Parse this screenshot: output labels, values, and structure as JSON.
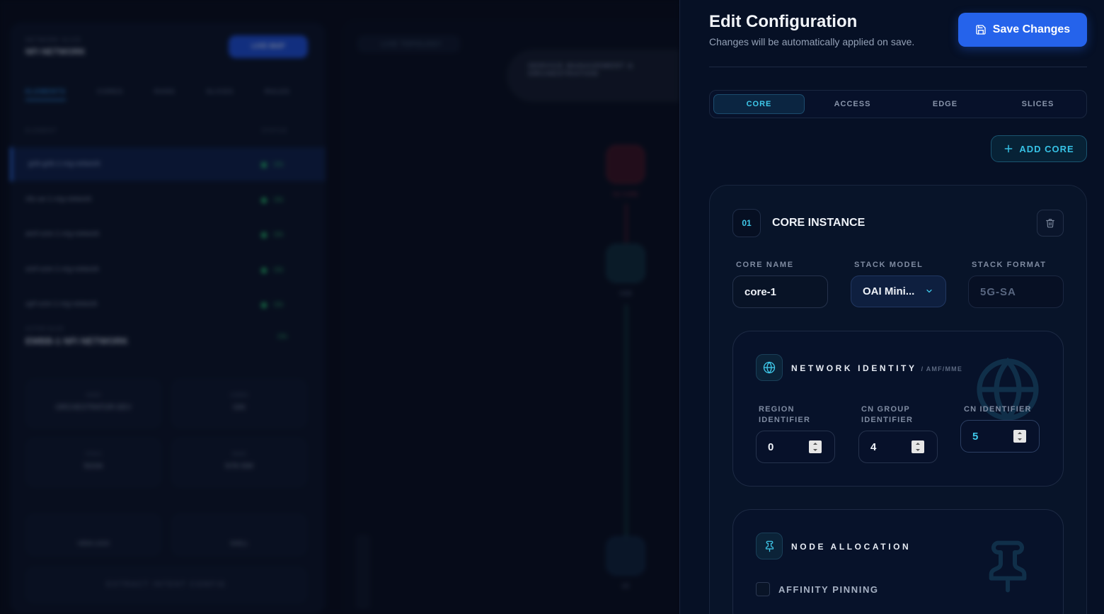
{
  "background_app": {
    "network_subtitle": "NETWORK SLICE",
    "network_title": "NFI NETWORK",
    "live_button": "LIVE MAP",
    "tabs": [
      "ELEMENTS",
      "CORES",
      "RANS",
      "SLICES",
      "RULES"
    ],
    "col_element": "ELEMENT",
    "col_status": "STATUS",
    "rows": [
      {
        "name": "gnb-gnb-1-nrg-network",
        "status": "ON"
      },
      {
        "name": "nfu-ue-1-nrg-network",
        "status": "ON"
      },
      {
        "name": "amf-core-1-nrg-network",
        "status": "ON"
      },
      {
        "name": "smf-core-1-nrg-network",
        "status": "ON"
      },
      {
        "name": "upf-core-1-nrg-network",
        "status": "ON"
      }
    ],
    "section_subtitle": "ACTIVE SLICE",
    "section_title": "EMBB-1 NFI NETWORK",
    "section_status": "ON",
    "stats": [
      {
        "label": "NODE",
        "value": "ORCHESTRATOR-DEV"
      },
      {
        "label": "CORES",
        "value": "OAI"
      },
      {
        "label": "STACK",
        "value": "5GSA"
      },
      {
        "label": "BAND",
        "value": "N78-SIM"
      }
    ],
    "actions": [
      "VIEW LOGS",
      "SHELL"
    ],
    "extract_button": "EXTRACT INTENT CONFIG",
    "topology_label": "LIVE TOPOLOGY",
    "bubble_text": "SERVICE MANAGEMENT & ORCHESTRATION",
    "nodes": [
      "5G CORE",
      "GNB",
      "UE"
    ]
  },
  "panel": {
    "title": "Edit Configuration",
    "subtitle": "Changes will be automatically applied on save.",
    "save_label": "Save Changes",
    "tabs": [
      "CORE",
      "ACCESS",
      "EDGE",
      "SLICES"
    ],
    "add_label": "ADD CORE",
    "core": {
      "index": "01",
      "title": "CORE INSTANCE",
      "name_label": "CORE NAME",
      "name_value": "core-1",
      "model_label": "STACK MODEL",
      "model_value": "OAI Mini...",
      "format_label": "STACK FORMAT",
      "format_value": "5G-SA",
      "identity": {
        "title": "NETWORK IDENTITY",
        "tag": "/ AMF/MME",
        "region_label_1": "REGION",
        "region_label_2": "IDENTIFIER",
        "region_value": "0",
        "group_label_1": "CN GROUP",
        "group_label_2": "IDENTIFIER",
        "group_value": "4",
        "cn_label": "CN IDENTIFIER",
        "cn_value": "5"
      },
      "allocation": {
        "title": "NODE ALLOCATION",
        "affinity_label": "AFFINITY PINNING"
      }
    }
  },
  "colors": {
    "accent": "#3fc8ea",
    "primary": "#2563eb",
    "panel_bg": "#061025"
  }
}
